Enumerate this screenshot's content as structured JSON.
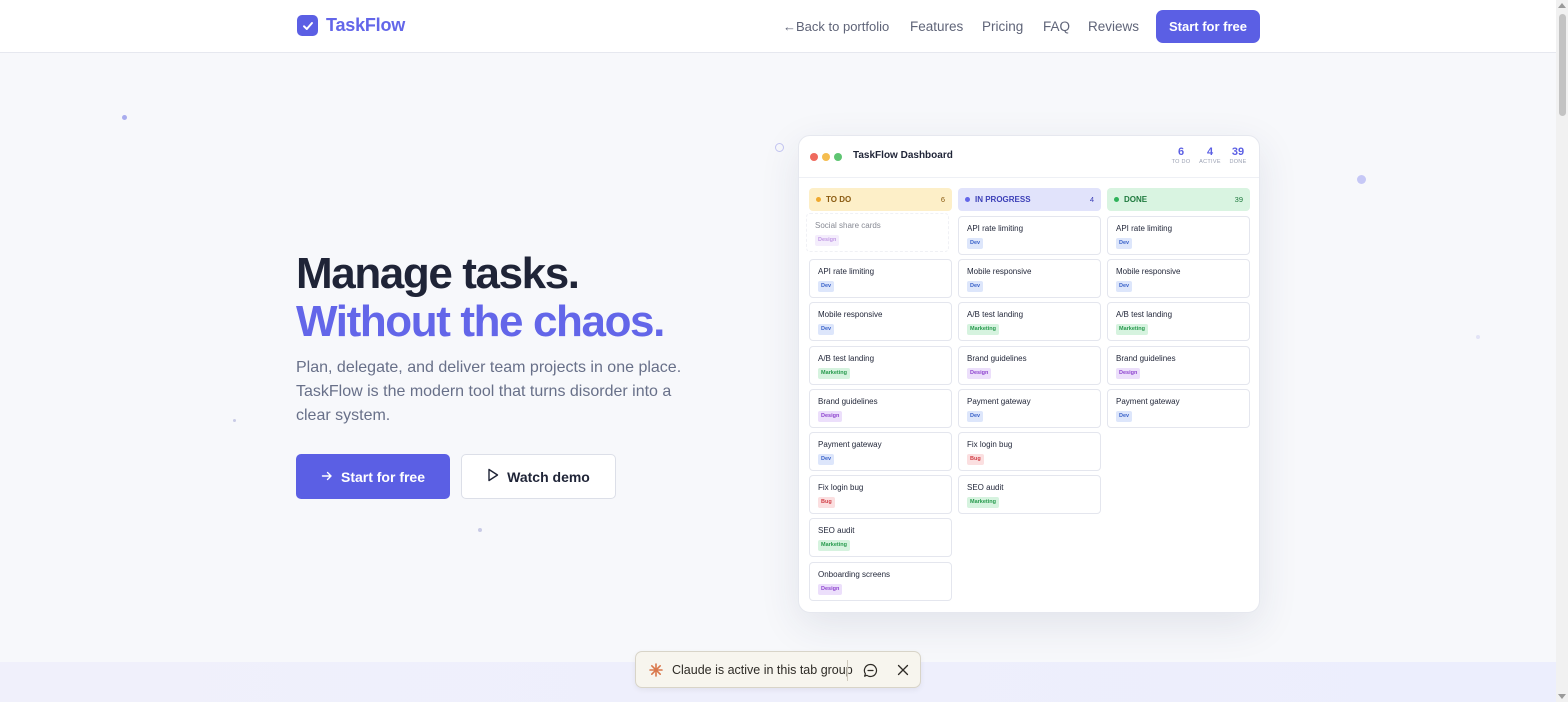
{
  "header": {
    "brand": "TaskFlow",
    "back_link": "←Back to portfolio",
    "nav": [
      "Features",
      "Pricing",
      "FAQ",
      "Reviews"
    ],
    "cta": "Start for free"
  },
  "hero": {
    "title_line1": "Manage tasks.",
    "title_line2": "Without the chaos.",
    "subtitle": "Plan, delegate, and deliver team projects in one place. TaskFlow is the modern tool that turns disorder into a clear system.",
    "primary_button": "Start for free",
    "secondary_button": "Watch demo"
  },
  "dashboard": {
    "title": "TaskFlow Dashboard",
    "stats": [
      {
        "value": "6",
        "label": "TO DO"
      },
      {
        "value": "4",
        "label": "ACTIVE"
      },
      {
        "value": "39",
        "label": "DONE"
      }
    ],
    "columns": [
      {
        "name": "TO DO",
        "count": "6",
        "color": "#f0a92d",
        "bg": "#fdefc8",
        "text_color": "#8a5a10",
        "ghost": {
          "title": "Social share cards",
          "tag": "Design"
        },
        "cards": [
          {
            "title": "API rate limiting",
            "tag": "Dev"
          },
          {
            "title": "Mobile responsive",
            "tag": "Dev"
          },
          {
            "title": "A/B test landing",
            "tag": "Marketing"
          },
          {
            "title": "Brand guidelines",
            "tag": "Design"
          },
          {
            "title": "Payment gateway",
            "tag": "Dev"
          },
          {
            "title": "Fix login bug",
            "tag": "Bug"
          },
          {
            "title": "SEO audit",
            "tag": "Marketing"
          },
          {
            "title": "Onboarding screens",
            "tag": "Design"
          }
        ]
      },
      {
        "name": "IN PROGRESS",
        "count": "4",
        "color": "#6366e9",
        "bg": "#e1e3fb",
        "text_color": "#3d40b8",
        "cards": [
          {
            "title": "API rate limiting",
            "tag": "Dev"
          },
          {
            "title": "Mobile responsive",
            "tag": "Dev"
          },
          {
            "title": "A/B test landing",
            "tag": "Marketing"
          },
          {
            "title": "Brand guidelines",
            "tag": "Design"
          },
          {
            "title": "Payment gateway",
            "tag": "Dev"
          },
          {
            "title": "Fix login bug",
            "tag": "Bug"
          },
          {
            "title": "SEO audit",
            "tag": "Marketing"
          }
        ]
      },
      {
        "name": "DONE",
        "count": "39",
        "color": "#2fb35a",
        "bg": "#d9f4e1",
        "text_color": "#1f7a3e",
        "cards": [
          {
            "title": "API rate limiting",
            "tag": "Dev"
          },
          {
            "title": "Mobile responsive",
            "tag": "Dev"
          },
          {
            "title": "A/B test landing",
            "tag": "Marketing"
          },
          {
            "title": "Brand guidelines",
            "tag": "Design"
          },
          {
            "title": "Payment gateway",
            "tag": "Dev"
          }
        ]
      }
    ]
  },
  "claude_bar": {
    "text": "Claude is active in this tab group"
  }
}
